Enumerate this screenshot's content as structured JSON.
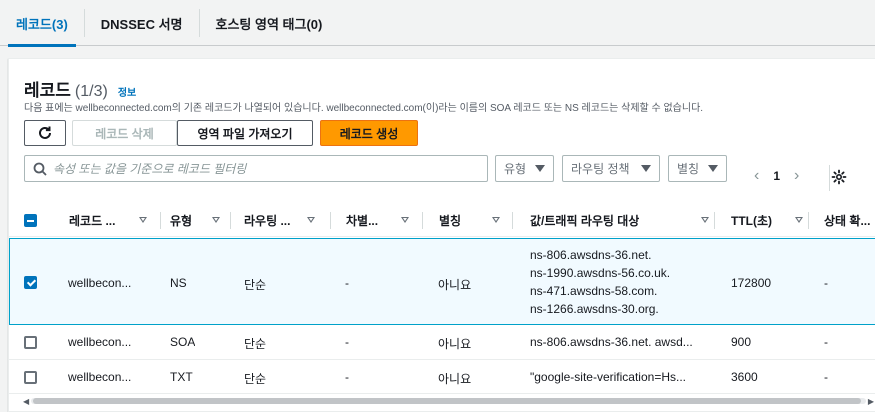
{
  "tabs": [
    {
      "label": "레코드(3)",
      "active": true
    },
    {
      "label": "DNSSEC 서명",
      "active": false
    },
    {
      "label": "호스팅 영역 태그(0)",
      "active": false
    }
  ],
  "panel": {
    "title": "레코드",
    "count": "(1/3)",
    "info_link": "정보",
    "description": "다음 표에는 wellbeconnected.com의 기존 레코드가 나열되어 있습니다. wellbeconnected.com(이)라는 이름의 SOA 레코드 또는 NS 레코드는 삭제할 수 없습니다."
  },
  "toolbar": {
    "refresh_icon": "refresh-icon",
    "delete_label": "레코드 삭제",
    "import_label": "영역 파일 가져오기",
    "create_label": "레코드 생성"
  },
  "filters": {
    "search_placeholder": "속성 또는 값을 기준으로 레코드 필터링",
    "type_label": "유형",
    "routing_label": "라우팅 정책",
    "alias_label": "별칭"
  },
  "pagination": {
    "prev": "‹",
    "page": "1",
    "next": "›"
  },
  "columns": [
    {
      "label": "레코드 ..."
    },
    {
      "label": "유형"
    },
    {
      "label": "라우팅 ..."
    },
    {
      "label": "차별..."
    },
    {
      "label": "별칭"
    },
    {
      "label": "값/트래픽 라우팅 대상"
    },
    {
      "label": "TTL(초)"
    },
    {
      "label": "상태 확..."
    }
  ],
  "rows": [
    {
      "selected": true,
      "name": "wellbecon...",
      "type": "NS",
      "routing": "단순",
      "diff": "-",
      "alias": "아니요",
      "values": [
        "ns-806.awsdns-36.net.",
        "ns-1990.awsdns-56.co.uk.",
        "ns-471.awsdns-58.com.",
        "ns-1266.awsdns-30.org."
      ],
      "ttl": "172800",
      "health": "-"
    },
    {
      "selected": false,
      "name": "wellbecon...",
      "type": "SOA",
      "routing": "단순",
      "diff": "-",
      "alias": "아니요",
      "values": [
        "ns-806.awsdns-36.net. awsd..."
      ],
      "ttl": "900",
      "health": "-"
    },
    {
      "selected": false,
      "name": "wellbecon...",
      "type": "TXT",
      "routing": "단순",
      "diff": "-",
      "alias": "아니요",
      "values": [
        "\"google-site-verification=Hs..."
      ],
      "ttl": "3600",
      "health": "-"
    }
  ],
  "colors": {
    "accent": "#0073bb",
    "primary_button": "#ff9900",
    "selected_row_bg": "#f1faff",
    "selected_row_border": "#00a1c9"
  }
}
